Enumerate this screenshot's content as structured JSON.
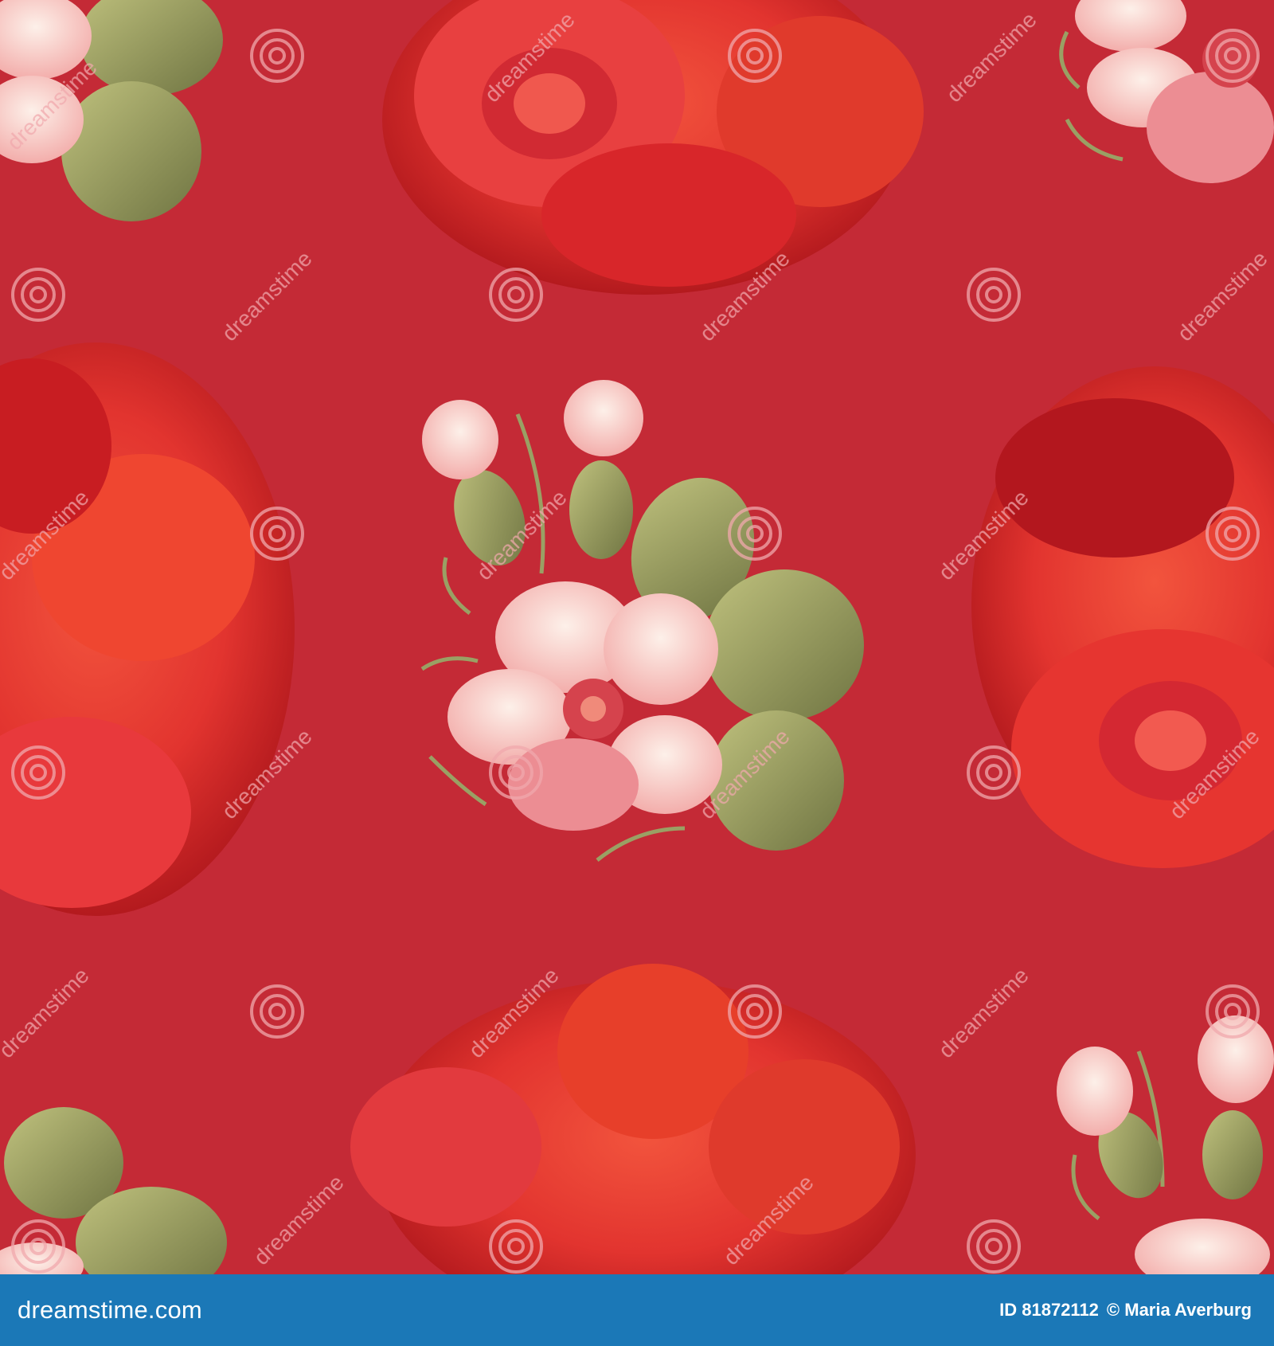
{
  "image": {
    "subject": "seamless floral pattern",
    "colors": {
      "background": "#c42a36",
      "rose": "#e2342f",
      "rose_dark": "#a9141a",
      "rose_light": "#f2543d",
      "petal_pink": "#f7cfc7",
      "petal_white": "#fdf0e9",
      "leaf": "#a8ad6a",
      "leaf_dark": "#7c8048",
      "watermark": "#f0a8ad",
      "footer": "#1b78b7"
    }
  },
  "watermark": {
    "repeat_text": "dreamstime"
  },
  "footer": {
    "brand": "dreamstime.com",
    "image_id": "ID 81872112",
    "author": "© Maria Averburg"
  }
}
